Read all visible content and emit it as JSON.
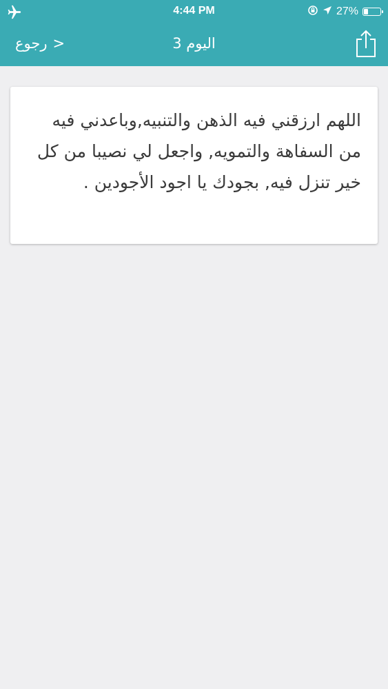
{
  "status_bar": {
    "time": "4:44 PM",
    "battery_percent": "27%",
    "battery_level": 0.27,
    "left_icon": "airplane-icon",
    "right_icons": [
      "orientation-lock-icon",
      "location-arrow-icon",
      "battery-icon"
    ]
  },
  "nav": {
    "back_label": "رجوع",
    "back_chevron": ">",
    "title": "اليوم 3",
    "share_icon": "share-icon"
  },
  "card": {
    "text": "اللهم ارزقني فيه الذهن والتنبيه,وباعدني فيه من السفاهة والتمويه, واجعل لي نصيبا من كل خير تنزل فيه, بجودك يا اجود الأجودين ."
  },
  "colors": {
    "header": "#3aabb4",
    "background": "#efeff1",
    "card": "#ffffff",
    "text": "#3a3a3a"
  }
}
